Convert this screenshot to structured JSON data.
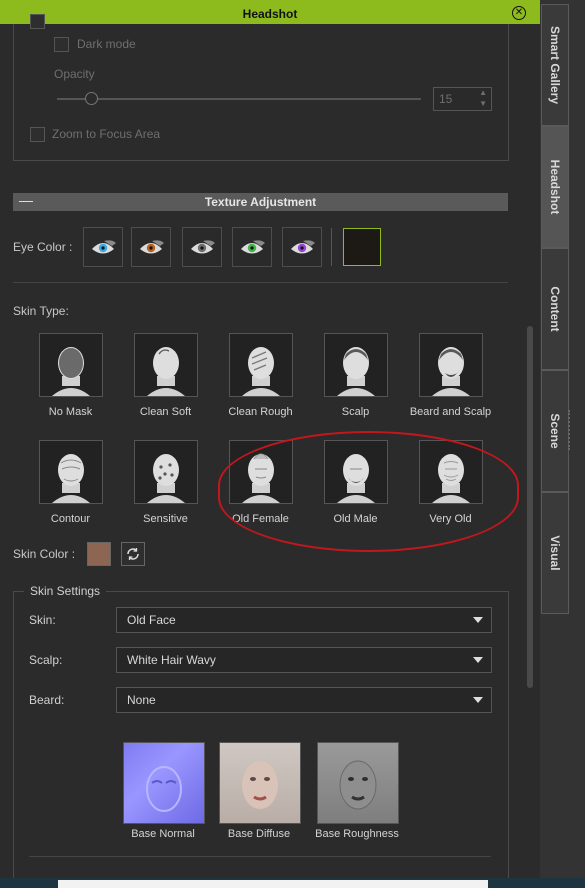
{
  "window": {
    "title": "Headshot"
  },
  "top_options": {
    "dark_mode_label": "Dark mode",
    "opacity_label": "Opacity",
    "opacity_value": "15",
    "zoom_label": "Zoom to Focus Area"
  },
  "texture_adjustment": {
    "header": "Texture Adjustment",
    "collapse_symbol": "—",
    "eye_color_label": "Eye Color :",
    "eye_colors": [
      "#36a9e6",
      "#b8611e",
      "#6f6f6f",
      "#3fb54a",
      "#9a43d6"
    ],
    "selected_swatch_color": "#1d1915"
  },
  "skin_type": {
    "label": "Skin Type:",
    "items": [
      {
        "label": "No Mask"
      },
      {
        "label": "Clean Soft"
      },
      {
        "label": "Clean Rough"
      },
      {
        "label": "Scalp"
      },
      {
        "label": "Beard and Scalp"
      },
      {
        "label": "Contour"
      },
      {
        "label": "Sensitive"
      },
      {
        "label": "Old Female"
      },
      {
        "label": "Old Male"
      },
      {
        "label": "Very Old"
      }
    ]
  },
  "skin_color": {
    "label": "Skin Color :",
    "color": "#8c6553"
  },
  "skin_settings": {
    "title": "Skin Settings",
    "skin_label": "Skin:",
    "skin_value": "Old Face",
    "scalp_label": "Scalp:",
    "scalp_value": "White Hair Wavy",
    "beard_label": "Beard:",
    "beard_value": "None",
    "textures": [
      {
        "label": "Base Normal"
      },
      {
        "label": "Base Diffuse"
      },
      {
        "label": "Base Roughness"
      }
    ]
  },
  "sidebar": {
    "tabs": [
      {
        "label": "Smart Gallery",
        "active": false
      },
      {
        "label": "Headshot",
        "active": true
      },
      {
        "label": "Content",
        "active": false
      },
      {
        "label": "Scene",
        "active": false
      },
      {
        "label": "Visual",
        "active": false
      }
    ]
  },
  "colors": {
    "accent": "#8dbb1d",
    "annotation": "#c2171d"
  }
}
